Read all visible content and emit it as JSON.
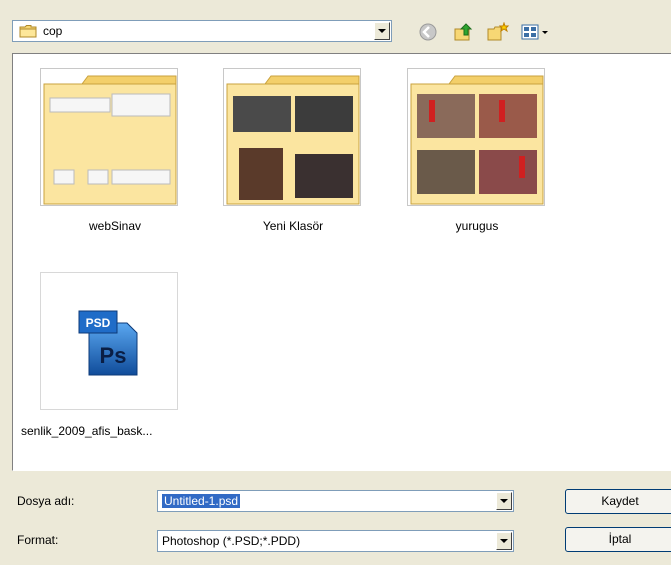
{
  "toolbar": {
    "look_in_value": "cop",
    "icons": [
      "back-icon",
      "up-folder-icon",
      "new-folder-icon",
      "view-menu-icon"
    ]
  },
  "items": [
    {
      "name": "webSinav",
      "type": "folder"
    },
    {
      "name": "Yeni Klasör",
      "type": "folder"
    },
    {
      "name": "yurugus",
      "type": "folder"
    },
    {
      "name": "senlik_2009_afis_bask...",
      "type": "psd"
    }
  ],
  "psd_icon": {
    "tab": "PSD",
    "letters": "Ps"
  },
  "form": {
    "filename_label": "Dosya adı:",
    "filename_value": "Untitled-1.psd",
    "format_label": "Format:",
    "format_value": "Photoshop (*.PSD;*.PDD)",
    "save_label": "Kaydet",
    "cancel_label": "İptal"
  },
  "colors": {
    "dialog_bg": "#ece9d8",
    "folder": "#f7d774",
    "selection": "#316ac5",
    "psd_blue": "#1f6cc8"
  }
}
